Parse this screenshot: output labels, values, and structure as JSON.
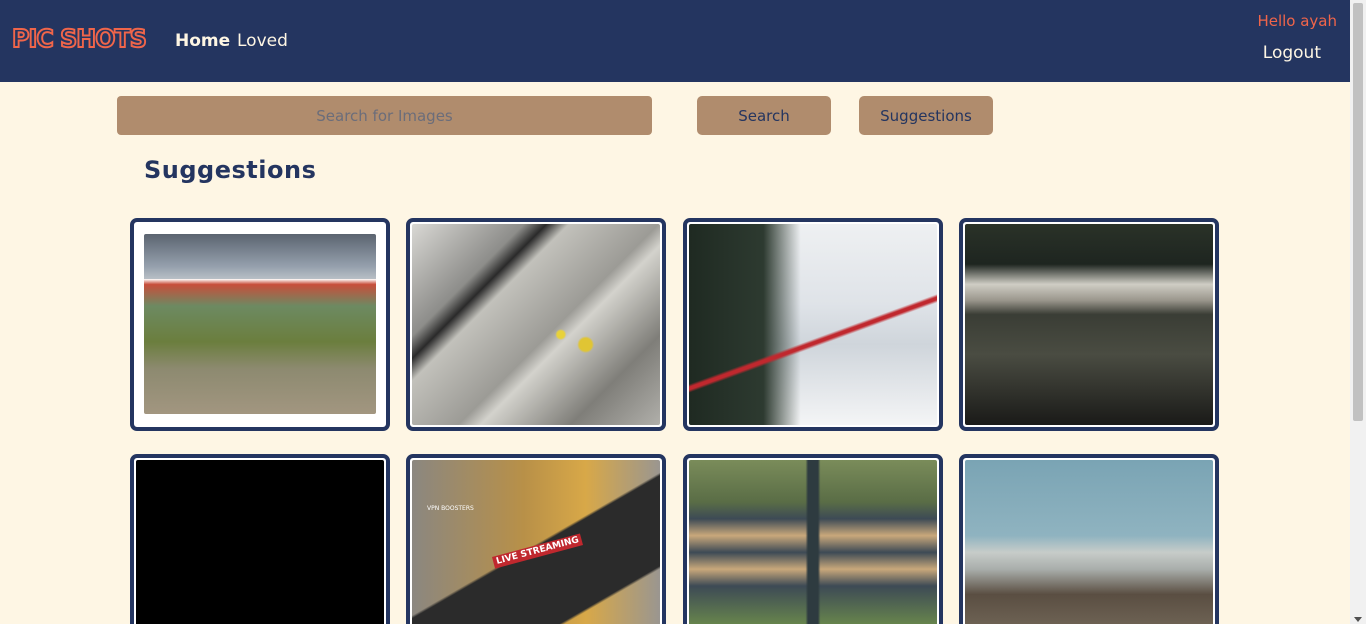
{
  "nav": {
    "logo": "PIC SHOTS",
    "links": [
      "Home",
      "Loved"
    ],
    "greeting": "Hello ayah",
    "logout": "Logout"
  },
  "search": {
    "placeholder": "Search for Images",
    "search_button": "Search",
    "suggestions_button": "Suggestions"
  },
  "section_title": "Suggestions",
  "gallery": [
    {
      "image": "vintage-truck-photo"
    },
    {
      "image": "flowers-on-rocks-photo"
    },
    {
      "image": "snowy-mountain-train-photo"
    },
    {
      "image": "waterfall-photo"
    },
    {
      "image": "black-placeholder-image"
    },
    {
      "image": "tablet-live-streaming-photo",
      "overlay_text": "LIVE STREAMING",
      "watermark": "VPN BOOSTERS"
    },
    {
      "image": "street-signs-photo"
    },
    {
      "image": "city-skyline-photo"
    }
  ],
  "colors": {
    "navbar": "#243560",
    "background": "#fef6e4",
    "accent": "#f0654a",
    "button": "#b08c6d"
  }
}
